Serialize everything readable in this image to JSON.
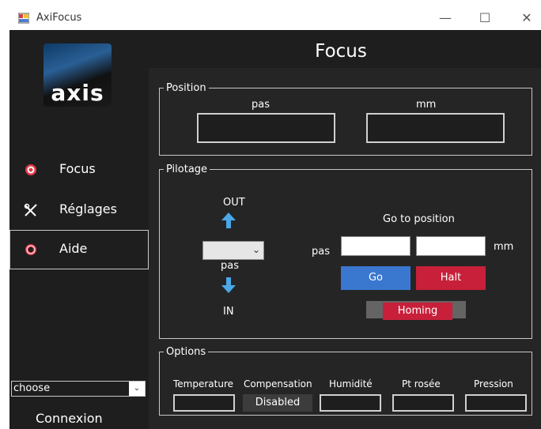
{
  "window": {
    "title": "AxiFocus",
    "minimize_glyph": "—",
    "maximize_glyph": "☐",
    "close_glyph": "✕"
  },
  "sidebar": {
    "logo_text": "axis",
    "items": [
      {
        "label": "Focus",
        "icon": "target-icon",
        "icon_color": "#e03a4a"
      },
      {
        "label": "Réglages",
        "icon": "tools-icon"
      },
      {
        "label": "Aide",
        "icon": "lifebuoy-icon",
        "icon_color": "#e03a4a",
        "active": true
      }
    ],
    "connection_select": {
      "value": "choose",
      "caret": "⌄"
    },
    "connexion_label": "Connexion"
  },
  "main": {
    "title": "Focus",
    "position": {
      "legend": "Position",
      "pas_label": "pas",
      "mm_label": "mm",
      "pas_value": "",
      "mm_value": ""
    },
    "pilotage": {
      "legend": "Pilotage",
      "out_label": "OUT",
      "in_label": "IN",
      "step_select": {
        "value": "",
        "caret": "⌄"
      },
      "step_unit": "pas",
      "goto_title": "Go to position",
      "goto_pas_label": "pas",
      "goto_mm_label": "mm",
      "goto_pas_value": "",
      "goto_mm_value": "",
      "go_button": "Go",
      "halt_button": "Halt",
      "homing_button": "Homing",
      "colors": {
        "go": "#3a78d0",
        "halt": "#c8203a",
        "homing_track": "#646464",
        "arrow": "#4aa8e8"
      }
    },
    "options": {
      "legend": "Options",
      "columns": [
        {
          "label": "Temperature",
          "value": ""
        },
        {
          "label": "Compensation",
          "value": "Disabled"
        },
        {
          "label": "Humidité",
          "value": ""
        },
        {
          "label": "Pt rosée",
          "value": ""
        },
        {
          "label": "Pression",
          "value": ""
        }
      ]
    }
  }
}
